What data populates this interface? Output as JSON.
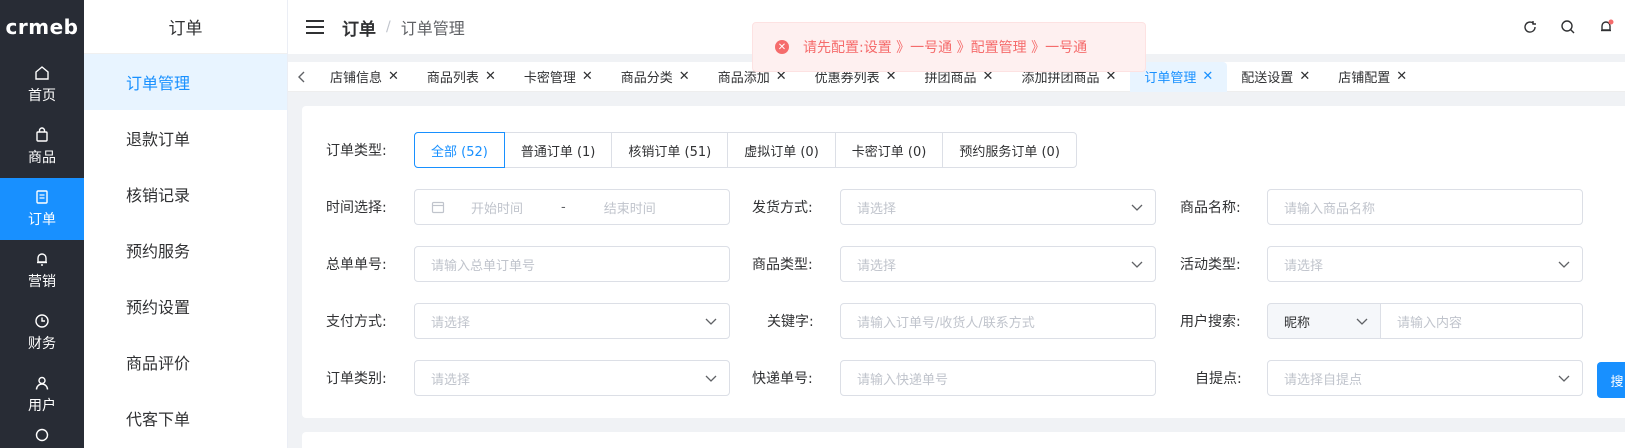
{
  "logo": "crmeb",
  "rail": [
    {
      "label": "首页",
      "icon": "home-icon"
    },
    {
      "label": "商品",
      "icon": "bag-icon"
    },
    {
      "label": "订单",
      "icon": "order-icon",
      "active": true
    },
    {
      "label": "营销",
      "icon": "bell-icon"
    },
    {
      "label": "财务",
      "icon": "clock-icon"
    },
    {
      "label": "用户",
      "icon": "user-icon"
    }
  ],
  "submenu": {
    "title": "订单",
    "items": [
      "订单管理",
      "退款订单",
      "核销记录",
      "预约服务",
      "预约设置",
      "商品评价",
      "代客下单"
    ]
  },
  "header": {
    "title": "订单",
    "separator": "/",
    "current": "订单管理"
  },
  "notice": {
    "text": "请先配置:设置 》一号通 》配置管理 》一号通",
    "color": "#f56c6c"
  },
  "tabs": [
    "店铺信息",
    "商品列表",
    "卡密管理",
    "商品分类",
    "商品添加",
    "优惠券列表",
    "拼团商品",
    "添加拼团商品",
    "订单管理",
    "配送设置",
    "店铺配置"
  ],
  "active_tab": "订单管理",
  "filters": {
    "order_type_label": "订单类型:",
    "order_types": [
      "全部 (52)",
      "普通订单 (1)",
      "核销订单 (51)",
      "虚拟订单 (0)",
      "卡密订单 (0)",
      "预约服务订单 (0)"
    ],
    "time_label": "时间选择:",
    "time_start": "开始时间",
    "time_dash": "-",
    "time_end": "结束时间",
    "ship_label": "发货方式:",
    "ship_ph": "请选择",
    "product_name_label": "商品名称:",
    "product_name_ph": "请输入商品名称",
    "total_no_label": "总单单号:",
    "total_no_ph": "请输入总单订单号",
    "product_type_label": "商品类型:",
    "product_type_ph": "请选择",
    "activity_label": "活动类型:",
    "activity_ph": "请选择",
    "pay_label": "支付方式:",
    "pay_ph": "请选择",
    "keyword_label": "关键字:",
    "keyword_ph": "请输入订单号/收货人/联系方式",
    "user_search_label": "用户搜索:",
    "user_search_type": "昵称",
    "user_search_ph": "请输入内容",
    "category_label": "订单类别:",
    "category_ph": "请选择",
    "express_label": "快递单号:",
    "express_ph": "请输入快递单号",
    "pickup_label": "自提点:",
    "pickup_ph": "请选择自提点",
    "search_btn": "搜"
  },
  "accent": "#1890ff"
}
